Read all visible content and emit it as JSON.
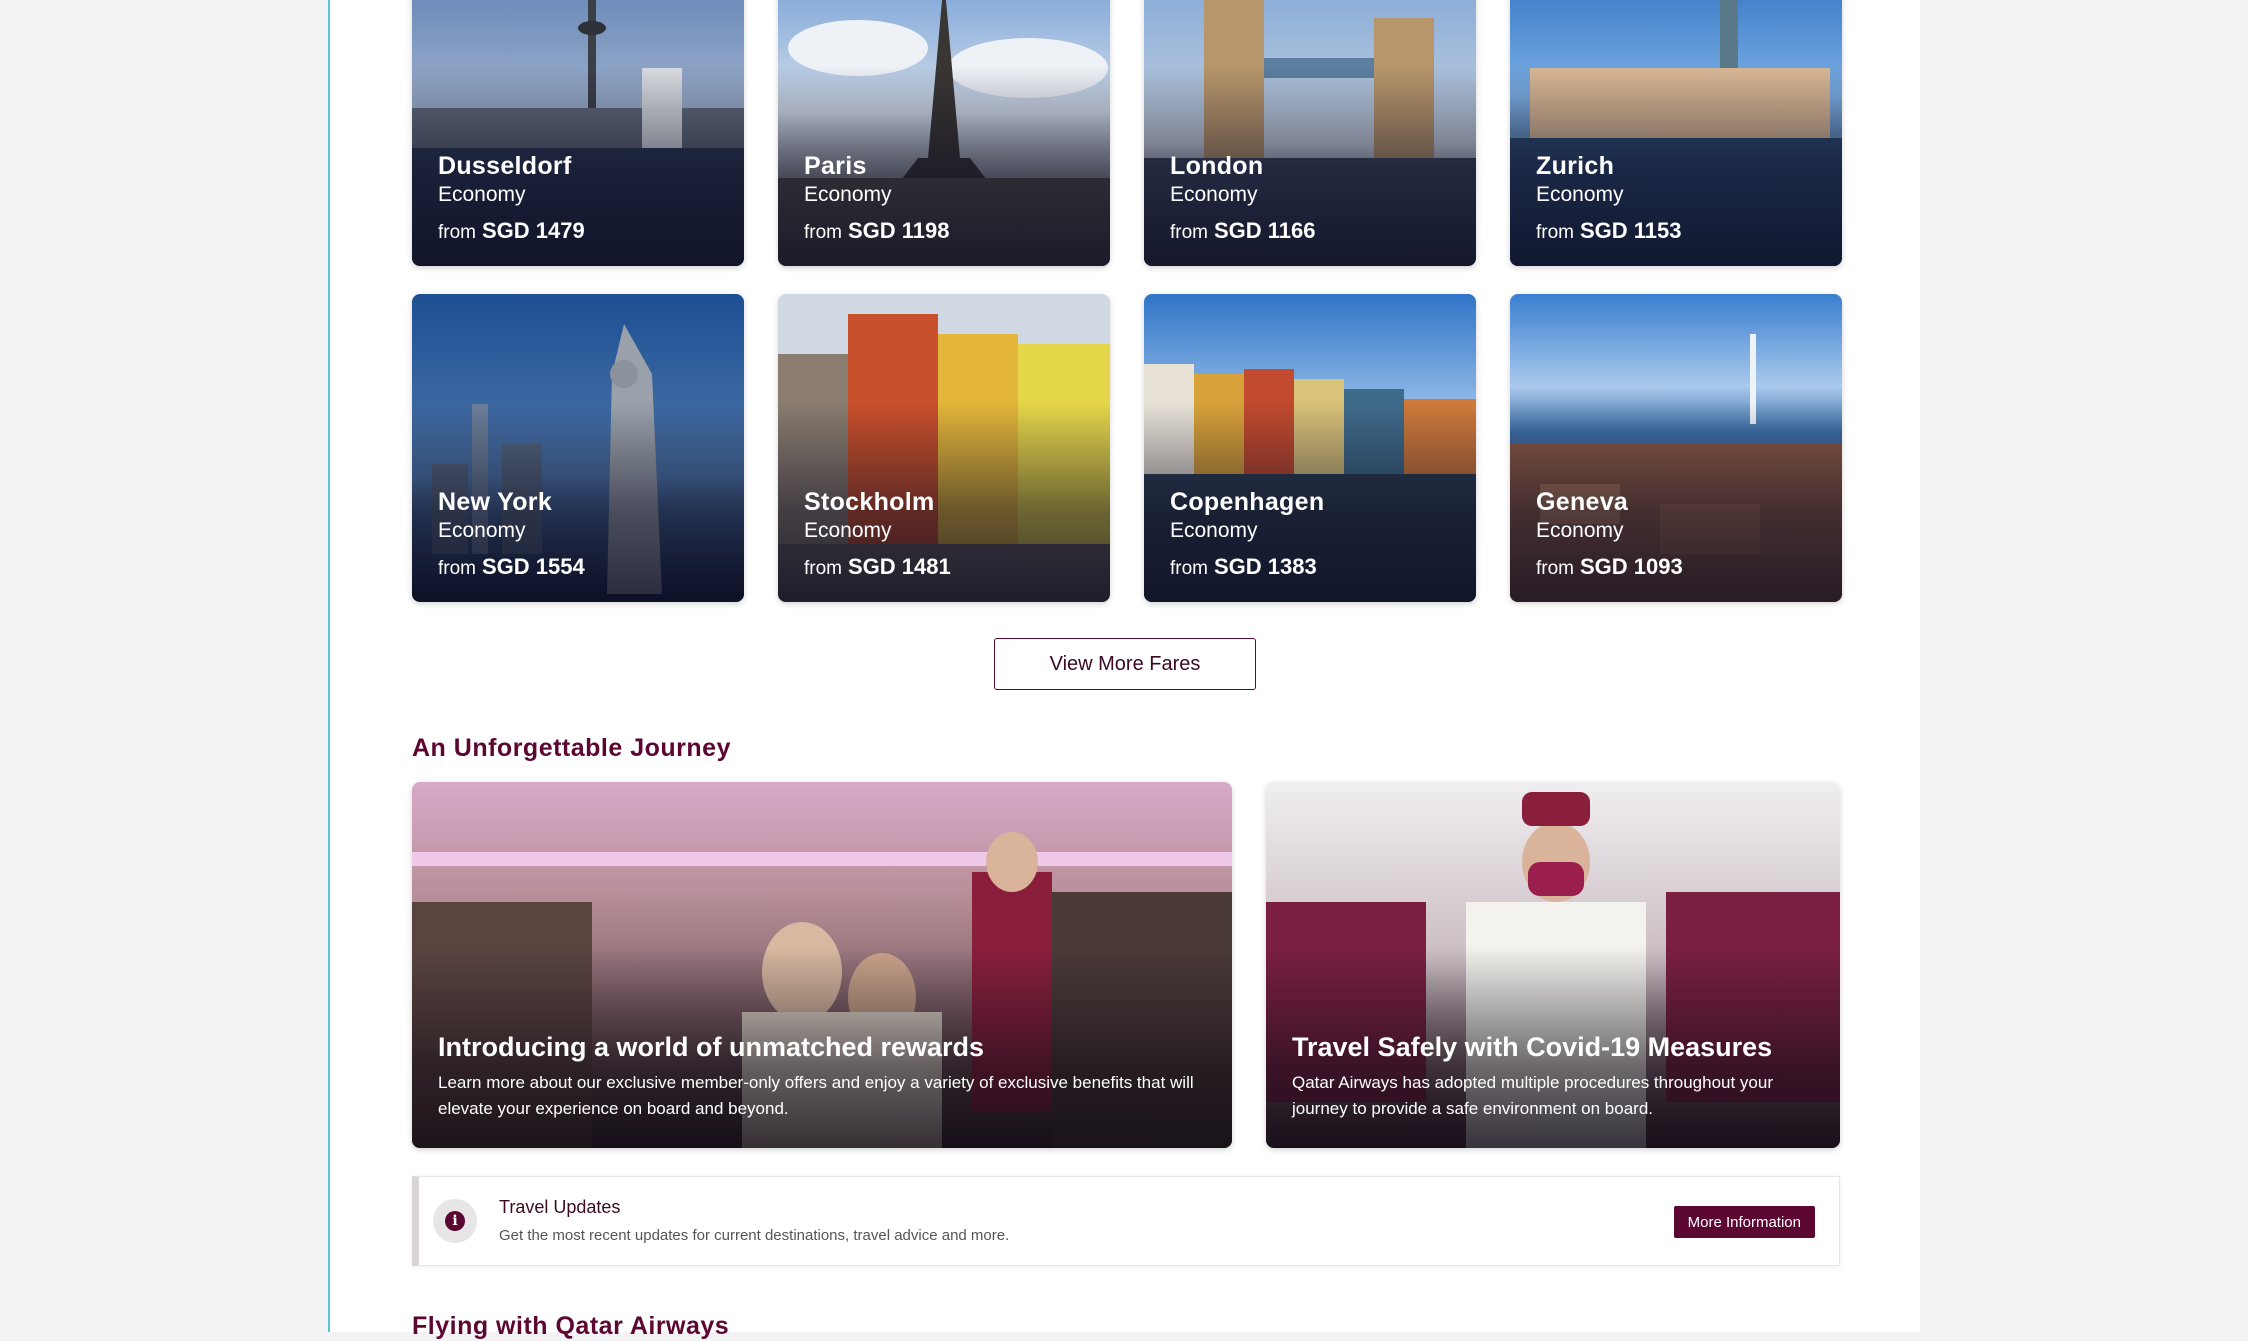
{
  "fares": [
    {
      "city": "Dusseldorf",
      "cabin": "Economy",
      "from": "from",
      "price": "SGD 1479",
      "icon": "dusseldorf-photo"
    },
    {
      "city": "Paris",
      "cabin": "Economy",
      "from": "from",
      "price": "SGD 1198",
      "icon": "paris-photo"
    },
    {
      "city": "London",
      "cabin": "Economy",
      "from": "from",
      "price": "SGD 1166",
      "icon": "london-photo"
    },
    {
      "city": "Zurich",
      "cabin": "Economy",
      "from": "from",
      "price": "SGD 1153",
      "icon": "zurich-photo"
    },
    {
      "city": "New York",
      "cabin": "Economy",
      "from": "from",
      "price": "SGD 1554",
      "icon": "new-york-photo"
    },
    {
      "city": "Stockholm",
      "cabin": "Economy",
      "from": "from",
      "price": "SGD 1481",
      "icon": "stockholm-photo"
    },
    {
      "city": "Copenhagen",
      "cabin": "Economy",
      "from": "from",
      "price": "SGD 1383",
      "icon": "copenhagen-photo"
    },
    {
      "city": "Geneva",
      "cabin": "Economy",
      "from": "from",
      "price": "SGD 1093",
      "icon": "geneva-photo"
    }
  ],
  "view_more_label": "View More Fares",
  "journey": {
    "title": "An Unforgettable Journey",
    "cards": [
      {
        "title": "Introducing a world of unmatched rewards",
        "desc": "Learn more about our exclusive member-only offers and enjoy a variety of exclusive benefits that will elevate your experience on board and beyond."
      },
      {
        "title": "Travel Safely with Covid-19 Measures",
        "desc": "Qatar Airways has adopted multiple procedures throughout your journey to provide a safe environment on board."
      }
    ]
  },
  "updates": {
    "icon": "info-icon",
    "title": "Travel Updates",
    "desc": "Get the most recent updates for current destinations, travel advice and more.",
    "button": "More Information"
  },
  "next_section_title": "Flying with Qatar Airways",
  "colors": {
    "brand": "#5c0632",
    "accent_border": "#5fc3d6"
  }
}
